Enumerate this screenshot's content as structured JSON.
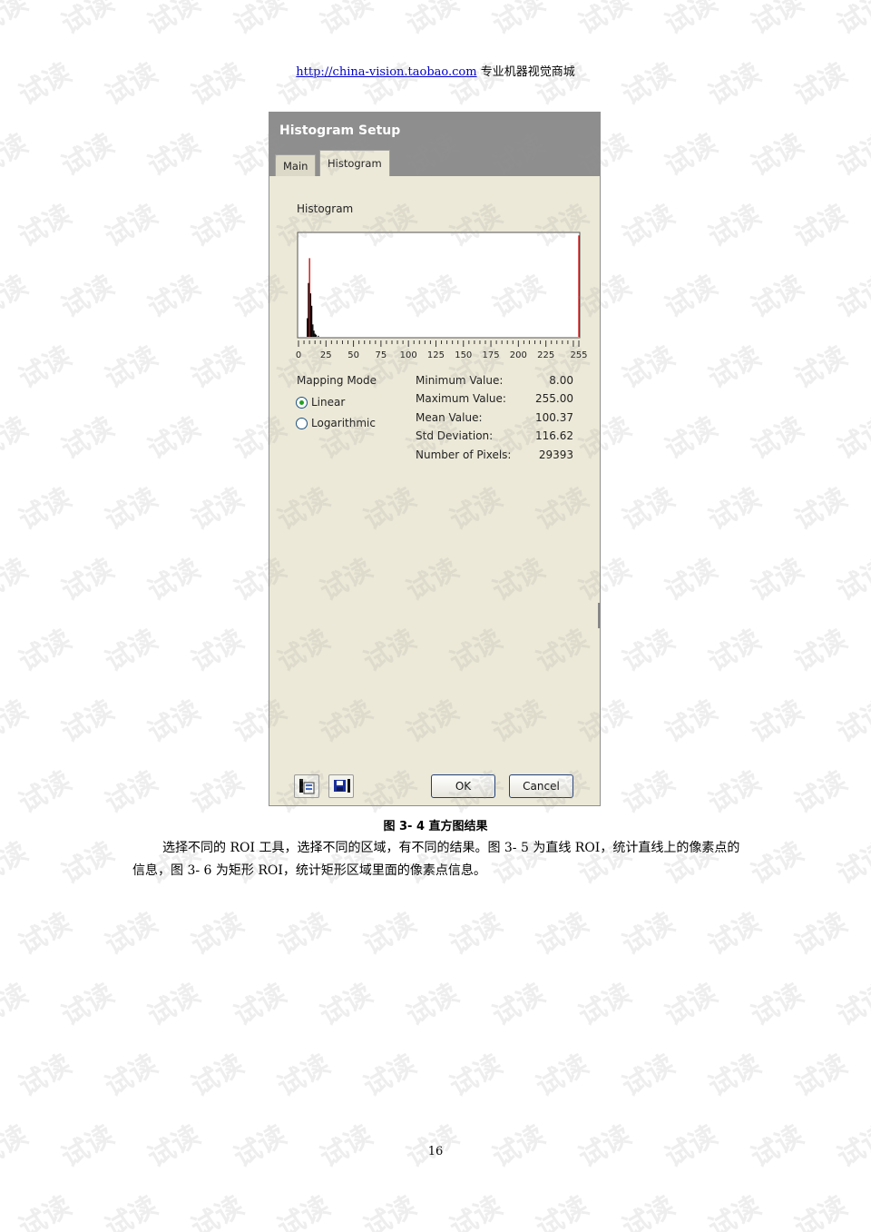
{
  "header": {
    "link_text": "http://china-vision.taobao.com",
    "suffix_text": " 专业机器视觉商城"
  },
  "dialog": {
    "title": "Histogram Setup",
    "tabs": [
      "Main",
      "Histogram"
    ],
    "active_tab": "Histogram",
    "histogram_label": "Histogram",
    "x_tick_labels": [
      "0",
      "25",
      "50",
      "75",
      "100",
      "125",
      "150",
      "175",
      "200",
      "225",
      "255"
    ],
    "mapping_mode_label": "Mapping Mode",
    "mapping_options": [
      {
        "label": "Linear",
        "selected": true
      },
      {
        "label": "Logarithmic",
        "selected": false
      }
    ],
    "stats": [
      {
        "label": "Minimum Value:",
        "value": "8.00"
      },
      {
        "label": "Maximum Value:",
        "value": "255.00"
      },
      {
        "label": "Mean Value:",
        "value": "100.37"
      },
      {
        "label": "Std Deviation:",
        "value": "116.62"
      },
      {
        "label": "Number of Pixels:",
        "value": "29393"
      }
    ],
    "buttons": {
      "ok": "OK",
      "cancel": "Cancel"
    },
    "icons": [
      "load-settings-icon",
      "save-settings-icon"
    ]
  },
  "chart_data": {
    "type": "bar",
    "title": "Histogram",
    "xlim": [
      0,
      255
    ],
    "x_ticks": [
      0,
      25,
      50,
      75,
      100,
      125,
      150,
      175,
      200,
      225,
      255
    ],
    "ylim": [
      0,
      1
    ],
    "grid": false,
    "bars": [
      {
        "x": 8,
        "value": 0.18,
        "color": "#000000"
      },
      {
        "x": 9,
        "value": 0.52,
        "color": "#000000"
      },
      {
        "x": 10,
        "value": 0.76,
        "color": "#cc0000"
      },
      {
        "x": 11,
        "value": 0.42,
        "color": "#000000"
      },
      {
        "x": 12,
        "value": 0.3,
        "color": "#000000"
      },
      {
        "x": 13,
        "value": 0.12,
        "color": "#000000"
      },
      {
        "x": 14,
        "value": 0.06,
        "color": "#000000"
      },
      {
        "x": 15,
        "value": 0.03,
        "color": "#000000"
      },
      {
        "x": 16,
        "value": 0.02,
        "color": "#000000"
      },
      {
        "x": 18,
        "value": 0.01,
        "color": "#000000"
      },
      {
        "x": 255,
        "value": 0.98,
        "color": "#cc0000"
      }
    ]
  },
  "caption": "图 3- 4 直方图结果",
  "body_text": "选择不同的 ROI 工具，选择不同的区域，有不同的结果。图 3- 5 为直线 ROI，统计直线上的像素点的信息，图 3- 6 为矩形 ROI，统计矩形区域里面的像素点信息。",
  "page_number": "16",
  "watermark_text": "试读"
}
